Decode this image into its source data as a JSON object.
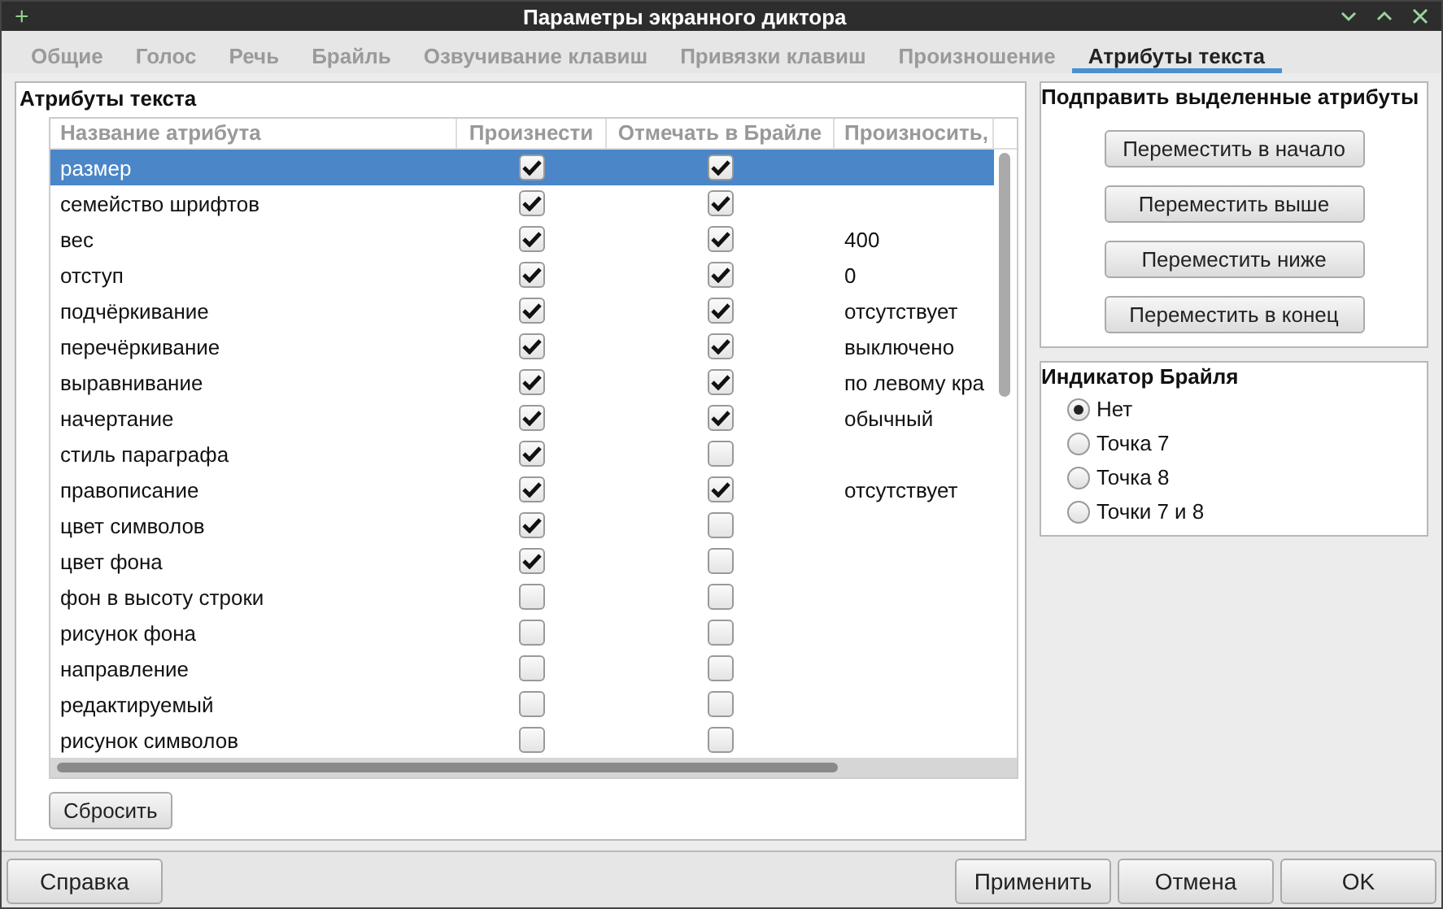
{
  "window": {
    "title": "Параметры экранного диктора",
    "controls": [
      "+"
    ]
  },
  "tabs": [
    {
      "label": "Общие",
      "selected": false
    },
    {
      "label": "Голос",
      "selected": false
    },
    {
      "label": "Речь",
      "selected": false
    },
    {
      "label": "Брайль",
      "selected": false
    },
    {
      "label": "Озвучивание клавиш",
      "selected": false
    },
    {
      "label": "Привязки клавиш",
      "selected": false
    },
    {
      "label": "Произношение",
      "selected": false
    },
    {
      "label": "Атрибуты текста",
      "selected": true
    }
  ],
  "attributes": {
    "title": "Атрибуты текста",
    "columns": [
      "Название атрибута",
      "Произнести",
      "Отмечать в Брайле",
      "Произносить,"
    ],
    "rows": [
      {
        "name": "размер",
        "speak": true,
        "braille": true,
        "value": "",
        "selected": true
      },
      {
        "name": "семейство шрифтов",
        "speak": true,
        "braille": true,
        "value": "",
        "selected": false
      },
      {
        "name": "вес",
        "speak": true,
        "braille": true,
        "value": "400",
        "selected": false
      },
      {
        "name": "отступ",
        "speak": true,
        "braille": true,
        "value": "0",
        "selected": false
      },
      {
        "name": "подчёркивание",
        "speak": true,
        "braille": true,
        "value": "отсутствует",
        "selected": false
      },
      {
        "name": "перечёркивание",
        "speak": true,
        "braille": true,
        "value": "выключено",
        "selected": false
      },
      {
        "name": "выравнивание",
        "speak": true,
        "braille": true,
        "value": "по левому кра",
        "selected": false
      },
      {
        "name": "начертание",
        "speak": true,
        "braille": true,
        "value": "обычный",
        "selected": false
      },
      {
        "name": "стиль параграфа",
        "speak": true,
        "braille": false,
        "value": "",
        "selected": false
      },
      {
        "name": "правописание",
        "speak": true,
        "braille": true,
        "value": "отсутствует",
        "selected": false
      },
      {
        "name": "цвет символов",
        "speak": true,
        "braille": false,
        "value": "",
        "selected": false
      },
      {
        "name": "цвет фона",
        "speak": true,
        "braille": false,
        "value": "",
        "selected": false
      },
      {
        "name": "фон в высоту строки",
        "speak": false,
        "braille": false,
        "value": "",
        "selected": false
      },
      {
        "name": "рисунок фона",
        "speak": false,
        "braille": false,
        "value": "",
        "selected": false
      },
      {
        "name": "направление",
        "speak": false,
        "braille": false,
        "value": "",
        "selected": false
      },
      {
        "name": "редактируемый",
        "speak": false,
        "braille": false,
        "value": "",
        "selected": false
      },
      {
        "name": "рисунок символов",
        "speak": false,
        "braille": false,
        "value": "",
        "selected": false
      }
    ],
    "reset_button": "Сбросить"
  },
  "adjust": {
    "title": "Подправить выделенные атрибуты",
    "buttons": [
      "Переместить в начало",
      "Переместить выше",
      "Переместить ниже",
      "Переместить в конец"
    ]
  },
  "braille_indicator": {
    "title": "Индикатор Брайля",
    "options": [
      {
        "label": "Нет",
        "selected": true
      },
      {
        "label": "Точка 7",
        "selected": false
      },
      {
        "label": "Точка 8",
        "selected": false
      },
      {
        "label": "Точки 7 и 8",
        "selected": false
      }
    ]
  },
  "footer": {
    "help": "Справка",
    "buttons": [
      "Применить",
      "Отмена",
      "OK"
    ]
  }
}
